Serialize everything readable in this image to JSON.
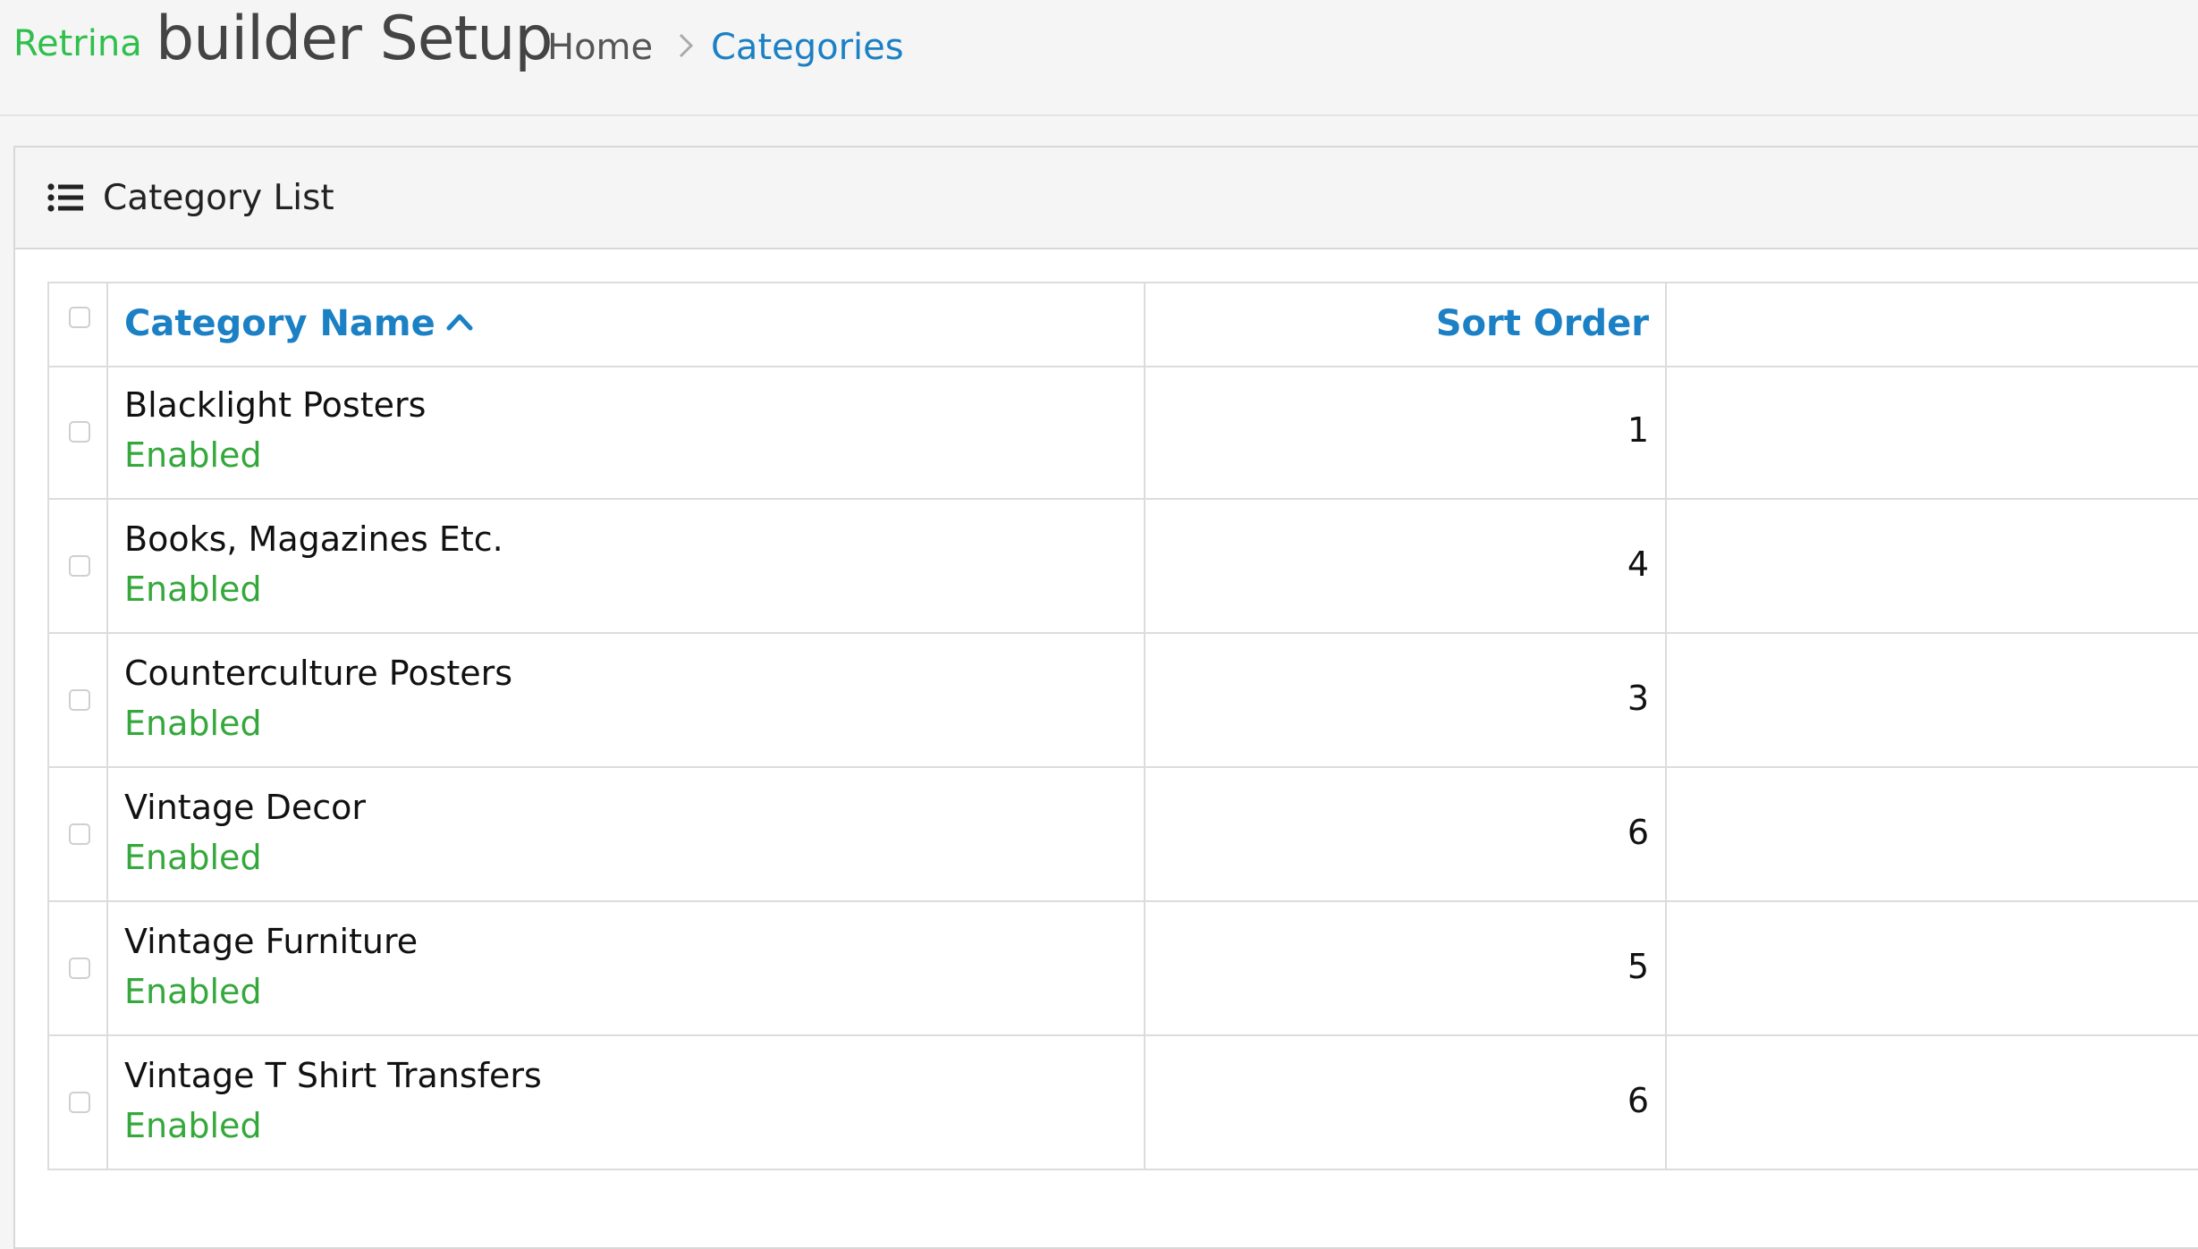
{
  "header": {
    "brand": "Retrina",
    "title": "builder Setup",
    "breadcrumb": {
      "home": "Home",
      "current": "Categories"
    }
  },
  "panel": {
    "title": "Category List",
    "icon": "list-icon"
  },
  "table": {
    "columns": {
      "name": "Category Name",
      "name_sort_direction": "ascending",
      "sort_order": "Sort Order"
    },
    "rows": [
      {
        "name": "Blacklight Posters",
        "status": "Enabled",
        "sort_order": "1"
      },
      {
        "name": "Books, Magazines Etc.",
        "status": "Enabled",
        "sort_order": "4"
      },
      {
        "name": "Counterculture Posters",
        "status": "Enabled",
        "sort_order": "3"
      },
      {
        "name": "Vintage Decor",
        "status": "Enabled",
        "sort_order": "6"
      },
      {
        "name": "Vintage Furniture",
        "status": "Enabled",
        "sort_order": "5"
      },
      {
        "name": "Vintage T Shirt Transfers",
        "status": "Enabled",
        "sort_order": "6"
      }
    ]
  },
  "colors": {
    "brand": "#2fbf4c",
    "link": "#1b80c4",
    "enabled": "#35a83c"
  }
}
